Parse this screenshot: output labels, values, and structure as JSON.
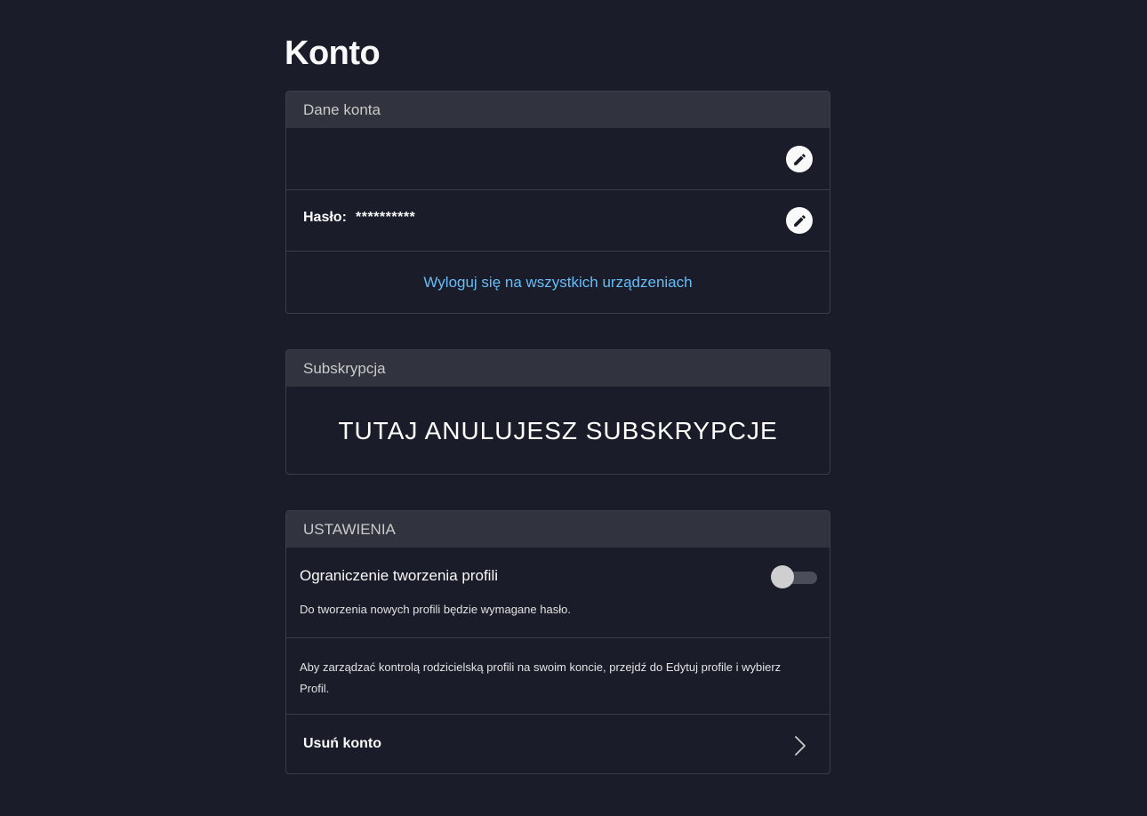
{
  "page": {
    "title": "Konto"
  },
  "account": {
    "header": "Dane konta",
    "email_value": "",
    "password_label": "Hasło:",
    "password_value": "**********",
    "logout_all": "Wyloguj się na wszystkich urządzeniach"
  },
  "subscription": {
    "header": "Subskrypcja",
    "overlay_text": "TUTAJ ANULUJESZ SUBSKRYPCJE"
  },
  "settings": {
    "header": "USTAWIENIA",
    "profile_restriction_title": "Ograniczenie tworzenia profili",
    "profile_restriction_desc": "Do tworzenia nowych profili będzie wymagane hasło.",
    "profile_restriction_enabled": false,
    "parental_info": "Aby zarządzać kontrolą rodzicielską profili na swoim koncie, przejdź do Edytuj profile i wybierz Profil.",
    "delete_account": "Usuń konto"
  },
  "icons": {
    "edit": "pencil-icon",
    "chevron": "chevron-right-icon"
  },
  "colors": {
    "background": "#1a1c29",
    "card_header": "#31343e",
    "link": "#67bdf8",
    "border": "#3a3d4b"
  }
}
